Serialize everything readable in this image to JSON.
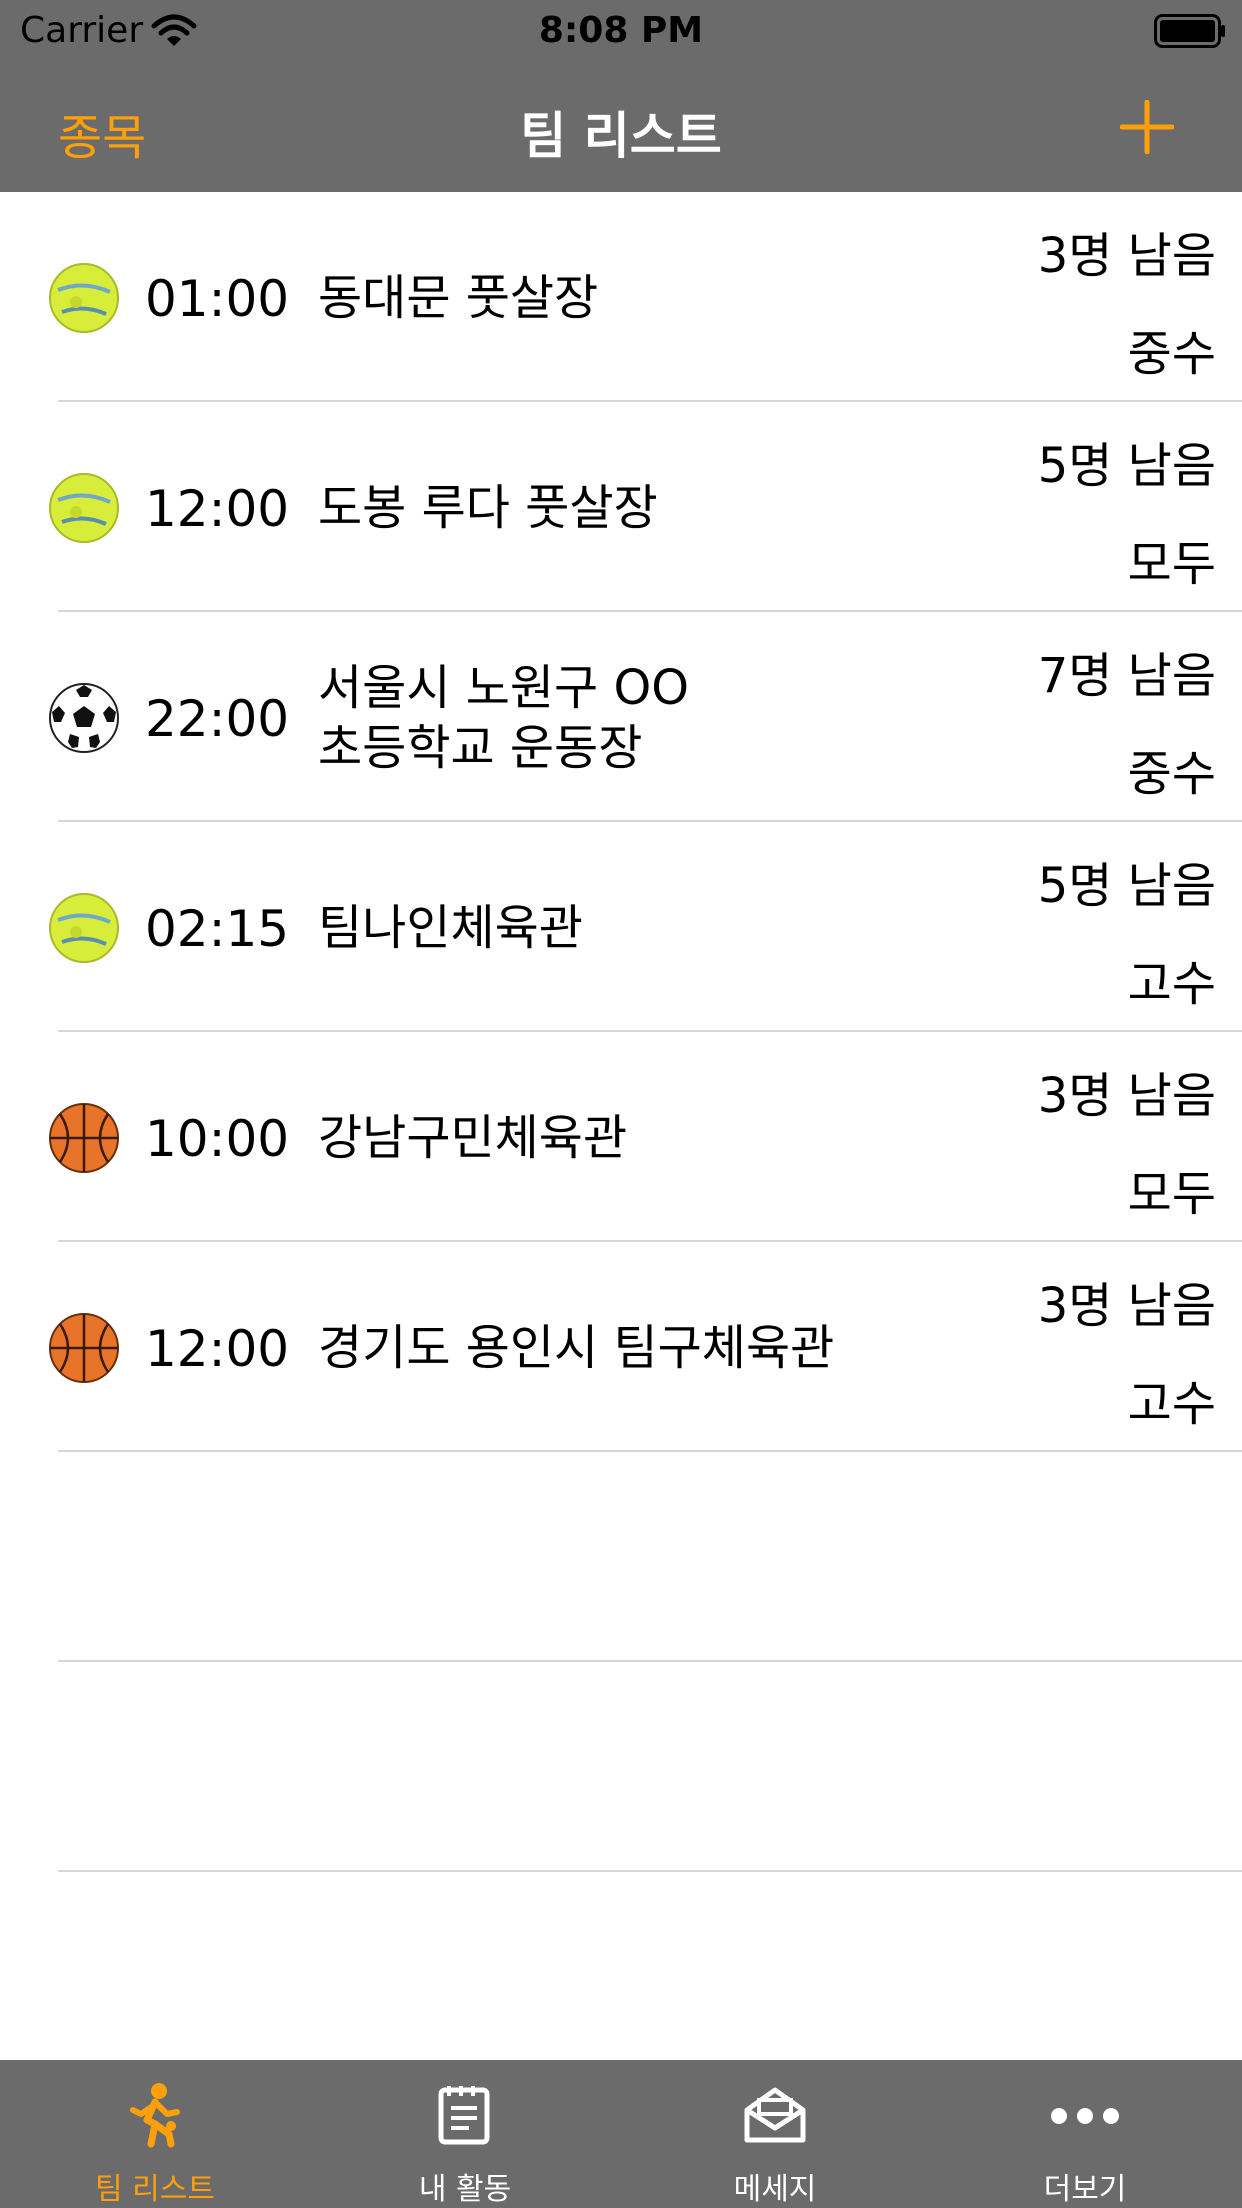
{
  "status_bar": {
    "carrier": "Carrier",
    "time": "8:08 PM"
  },
  "nav": {
    "left_label": "종목",
    "title": "팀 리스트",
    "add_icon": "plus-icon"
  },
  "colors": {
    "accent": "#ff9f0a",
    "bar_bg": "#6b6b6b",
    "separator": "#d6d6d6"
  },
  "rows": [
    {
      "sport": "futsal",
      "time": "01:00",
      "place": "동대문 풋살장",
      "remain": "3명 남음",
      "level": "중수"
    },
    {
      "sport": "futsal",
      "time": "12:00",
      "place": "도봉 루다 풋살장",
      "remain": "5명 남음",
      "level": "모두"
    },
    {
      "sport": "soccer",
      "time": "22:00",
      "place_line1": "서울시 노원구 OO",
      "place_line2": "초등학교 운동장",
      "remain": "7명 남음",
      "level": "중수"
    },
    {
      "sport": "futsal",
      "time": "02:15",
      "place": "팀나인체육관",
      "remain": "5명 남음",
      "level": "고수"
    },
    {
      "sport": "basketball",
      "time": "10:00",
      "place": "강남구민체육관",
      "remain": "3명 남음",
      "level": "모두"
    },
    {
      "sport": "basketball",
      "time": "12:00",
      "place": "경기도 용인시 팀구체육관",
      "remain": "3명 남음",
      "level": "고수"
    }
  ],
  "tabs": [
    {
      "label": "팀 리스트",
      "icon": "runner-icon",
      "active": true
    },
    {
      "label": "내 활동",
      "icon": "notepad-icon",
      "active": false
    },
    {
      "label": "메세지",
      "icon": "envelope-icon",
      "active": false
    },
    {
      "label": "더보기",
      "icon": "more-icon",
      "active": false
    }
  ]
}
